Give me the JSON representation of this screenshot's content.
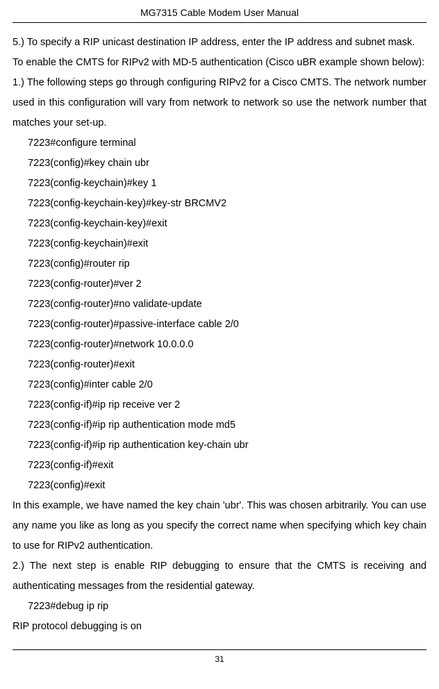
{
  "header": {
    "title": "MG7315 Cable Modem User Manual"
  },
  "content": {
    "p1": "5.) To specify a RIP unicast destination IP address, enter the IP address and subnet mask.",
    "p2": "To enable the CMTS for RIPv2 with MD-5 authentication (Cisco uBR example shown below):",
    "p3": "1.) The following steps go through configuring RIPv2 for a Cisco CMTS. The network number used in this configuration will vary from network to network so use the network number that matches your set-up.",
    "terminal": [
      "7223#configure terminal",
      "7223(config)#key chain ubr",
      "7223(config-keychain)#key 1",
      "7223(config-keychain-key)#key-str BRCMV2",
      "7223(config-keychain-key)#exit",
      "7223(config-keychain)#exit",
      "7223(config)#router rip",
      "7223(config-router)#ver 2",
      "7223(config-router)#no validate-update",
      "7223(config-router)#passive-interface cable 2/0",
      "7223(config-router)#network 10.0.0.0",
      "7223(config-router)#exit",
      "7223(config)#inter cable 2/0",
      "7223(config-if)#ip rip receive ver 2",
      "7223(config-if)#ip rip authentication mode md5",
      "7223(config-if)#ip rip authentication key-chain ubr",
      "7223(config-if)#exit",
      "7223(config)#exit"
    ],
    "p4": "In this example, we have named the key chain 'ubr'. This was chosen arbitrarily. You can use any name you like as long as you specify the correct name when specifying which key chain to use for RIPv2 authentication.",
    "p5": "2.) The next step is enable RIP debugging to ensure that the CMTS is receiving and authenticating messages from the residential gateway.",
    "terminal2": [
      "7223#debug ip rip"
    ],
    "p6": "RIP protocol debugging is on"
  },
  "footer": {
    "page_number": "31"
  }
}
